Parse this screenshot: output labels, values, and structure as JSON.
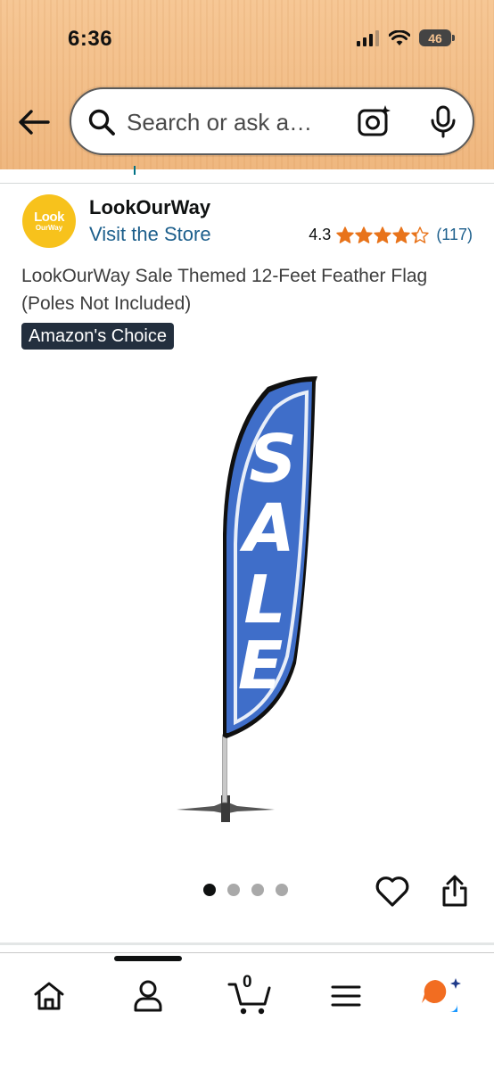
{
  "status_bar": {
    "time": "6:36",
    "battery": "46"
  },
  "search": {
    "placeholder": "Search or ask a…"
  },
  "icons": {
    "back": "arrow-left-icon",
    "search": "search-icon",
    "camera": "camera-scan-icon",
    "mic": "microphone-icon",
    "heart": "heart-icon",
    "share": "share-icon",
    "home": "home-icon",
    "account": "person-icon",
    "cart": "cart-icon",
    "menu": "menu-icon",
    "rufus": "rufus-chat-icon"
  },
  "seller": {
    "logo_line1": "Look",
    "logo_line2": "OurWay",
    "name": "LookOurWay",
    "store_link": "Visit the Store",
    "rating": "4.3",
    "rating_stars": 4.3,
    "review_count": "(117)"
  },
  "product": {
    "title": "LookOurWay Sale Themed 12-Feet Feather Flag (Poles Not Included)",
    "badge": "Amazon's Choice",
    "flag_text": [
      "S",
      "A",
      "L",
      "E"
    ]
  },
  "carousel": {
    "total": 4,
    "active_index": 0
  },
  "bottom_nav": {
    "cart_count": "0",
    "active_tab": "home"
  },
  "colors": {
    "header_bg": "#f2bd86",
    "link": "#1d5f8c",
    "star": "#e8731a",
    "badge_bg": "#232f3e",
    "flag_blue": "#3f6ec9",
    "logo_yellow": "#f7c21c",
    "rufus_orange": "#f26d21",
    "rufus_blue": "#1a98ff"
  }
}
